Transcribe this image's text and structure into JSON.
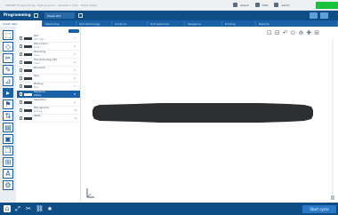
{
  "titlebar": {
    "title": "TRUMPF Programming - Part program - Operation data - Sheet metal",
    "user_items": [
      "Ablauf",
      "Hilfe",
      "Admin"
    ]
  },
  "toolbar": {
    "mode_label": "Programming",
    "dropdown_value": "Sheet 001"
  },
  "tabs": [
    {
      "label": "Sheet data"
    },
    {
      "label": "Machining"
    },
    {
      "label": "Tool technology"
    },
    {
      "label": "Contours"
    },
    {
      "label": "Tool sequence"
    },
    {
      "label": "Sequence"
    },
    {
      "label": "Printing"
    },
    {
      "label": "Reports"
    }
  ],
  "part_list": [
    {
      "name": "Part",
      "sub": "Part data",
      "num": "1"
    },
    {
      "name": "Part contour",
      "sub": "Outer",
      "num": "2"
    },
    {
      "name": "Machining",
      "sub": "Inner",
      "num": "3"
    },
    {
      "name": "Tool technology 001",
      "sub": "Laser",
      "num": "4"
    },
    {
      "name": "Microjoint",
      "sub": "",
      "num": "5"
    },
    {
      "name": "Slug",
      "sub": "",
      "num": "6"
    },
    {
      "name": "Marking",
      "sub": "Text",
      "num": "7"
    },
    {
      "name": "Sequence",
      "sub": "Active",
      "num": "8"
    },
    {
      "name": "Separation",
      "sub": "",
      "num": "9"
    },
    {
      "name": "Part removal",
      "sub": "Sorting",
      "num": "10"
    },
    {
      "name": "Pallet",
      "sub": "",
      "num": "11"
    }
  ],
  "selected_row_index": 7,
  "left_tools": [
    "select-icon",
    "contour-icon",
    "cut-icon",
    "edit-icon",
    "measure-icon",
    "play-icon",
    "flag-icon",
    "sort-icon",
    "layer-icon",
    "image-icon",
    "copy-icon",
    "grid-icon",
    "text-icon",
    "settings-icon"
  ],
  "view_tools": [
    "⊡",
    "⊟",
    "↶",
    "⊙",
    "⊕",
    "✚",
    "⊞"
  ],
  "bottom": {
    "start_label": "Start cycle"
  },
  "colors": {
    "brand_dark": "#0f4d86",
    "brand": "#1a62a8",
    "accent_green": "#19c23a",
    "part_fill": "#2e2f31"
  }
}
